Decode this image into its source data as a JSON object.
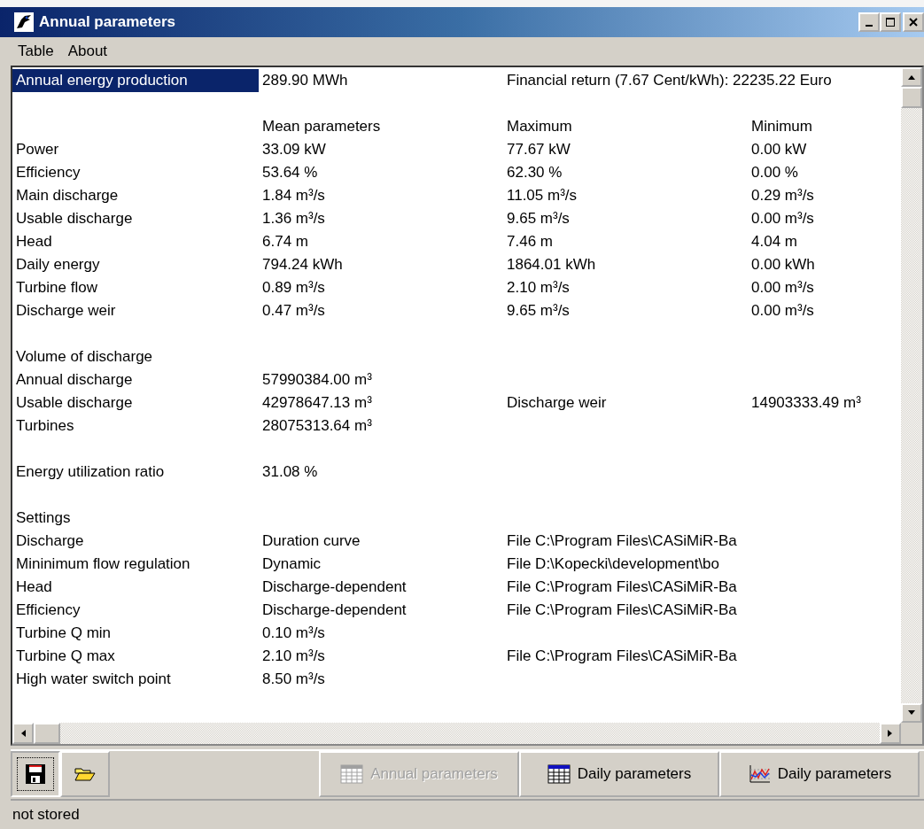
{
  "window": {
    "title": "Annual parameters"
  },
  "menu": [
    "Table",
    "About"
  ],
  "rows": [
    {
      "selected": true,
      "column_1": "Annual energy production",
      "column_2": "289.90 MWh",
      "column_3": "Financial return (7.67 Cent/kWh): 22235.22 Euro"
    },
    {
      "selected": false
    },
    {
      "selected": false,
      "column_2": "Mean parameters",
      "column_3": "Maximum",
      "column_4": "Minimum"
    },
    {
      "selected": false,
      "column_1": "Power",
      "column_2": "33.09 kW",
      "column_3": "77.67 kW",
      "column_4": "0.00 kW"
    },
    {
      "selected": false,
      "column_1": "Efficiency",
      "column_2": "53.64 %",
      "column_3": "62.30 %",
      "column_4": "0.00 %"
    },
    {
      "selected": false,
      "column_1": "Main discharge",
      "column_2": "1.84 m³/s",
      "column_3": "11.05 m³/s",
      "column_4": "0.29 m³/s"
    },
    {
      "selected": false,
      "column_1": "Usable discharge",
      "column_2": "1.36 m³/s",
      "column_3": "9.65 m³/s",
      "column_4": "0.00 m³/s"
    },
    {
      "selected": false,
      "column_1": "Head",
      "column_2": "6.74 m",
      "column_3": "7.46 m",
      "column_4": "4.04 m"
    },
    {
      "selected": false,
      "column_1": "Daily energy",
      "column_2": "794.24 kWh",
      "column_3": "1864.01 kWh",
      "column_4": "0.00 kWh"
    },
    {
      "selected": false,
      "column_1": "Turbine flow",
      "column_2": "0.89 m³/s",
      "column_3": "2.10 m³/s",
      "column_4": "0.00 m³/s"
    },
    {
      "selected": false,
      "column_1": "Discharge weir",
      "column_2": "0.47 m³/s",
      "column_3": "9.65 m³/s",
      "column_4": "0.00 m³/s"
    },
    {
      "selected": false
    },
    {
      "selected": false,
      "column_1": "Volume of discharge"
    },
    {
      "selected": false,
      "column_1": "Annual discharge",
      "column_2": "57990384.00 m³"
    },
    {
      "selected": false,
      "column_1": "Usable discharge",
      "column_2": "42978647.13 m³",
      "column_3": "Discharge weir",
      "column_4": "14903333.49 m³"
    },
    {
      "selected": false,
      "column_1": "Turbines",
      "column_2": "28075313.64 m³"
    },
    {
      "selected": false
    },
    {
      "selected": false,
      "column_1": "Energy utilization ratio",
      "column_2": "31.08 %"
    },
    {
      "selected": false
    },
    {
      "selected": false,
      "column_1": "Settings"
    },
    {
      "selected": false,
      "column_1": "Discharge",
      "column_2": "Duration curve",
      "column_3": "File C:\\Program Files\\CASiMiR-Ba"
    },
    {
      "selected": false,
      "column_1": "Mininimum flow regulation",
      "column_2": "Dynamic",
      "column_3": "File D:\\Kopecki\\development\\bo"
    },
    {
      "selected": false,
      "column_1": "Head",
      "column_2": "Discharge-dependent",
      "column_3": "File C:\\Program Files\\CASiMiR-Ba"
    },
    {
      "selected": false,
      "column_1": "Efficiency",
      "column_2": "Discharge-dependent",
      "column_3": "File C:\\Program Files\\CASiMiR-Ba"
    },
    {
      "selected": false,
      "column_1": "Turbine Q min",
      "column_2": "0.10 m³/s"
    },
    {
      "selected": false,
      "column_1": "Turbine Q max",
      "column_2": "2.10 m³/s",
      "column_3": "File C:\\Program Files\\CASiMiR-Ba"
    },
    {
      "selected": false,
      "column_1": "High water switch point",
      "column_2": "8.50 m³/s"
    }
  ],
  "toolbar": [
    {
      "kind": "save",
      "pressed": true
    },
    {
      "kind": "open",
      "pressed": false
    }
  ],
  "view_buttons": [
    {
      "kind": "table",
      "label": "Annual parameters",
      "disabled": true
    },
    {
      "kind": "table",
      "label": "Daily parameters",
      "disabled": false
    },
    {
      "kind": "chart",
      "label": "Daily parameters",
      "disabled": false
    }
  ],
  "status_bar": "not stored"
}
